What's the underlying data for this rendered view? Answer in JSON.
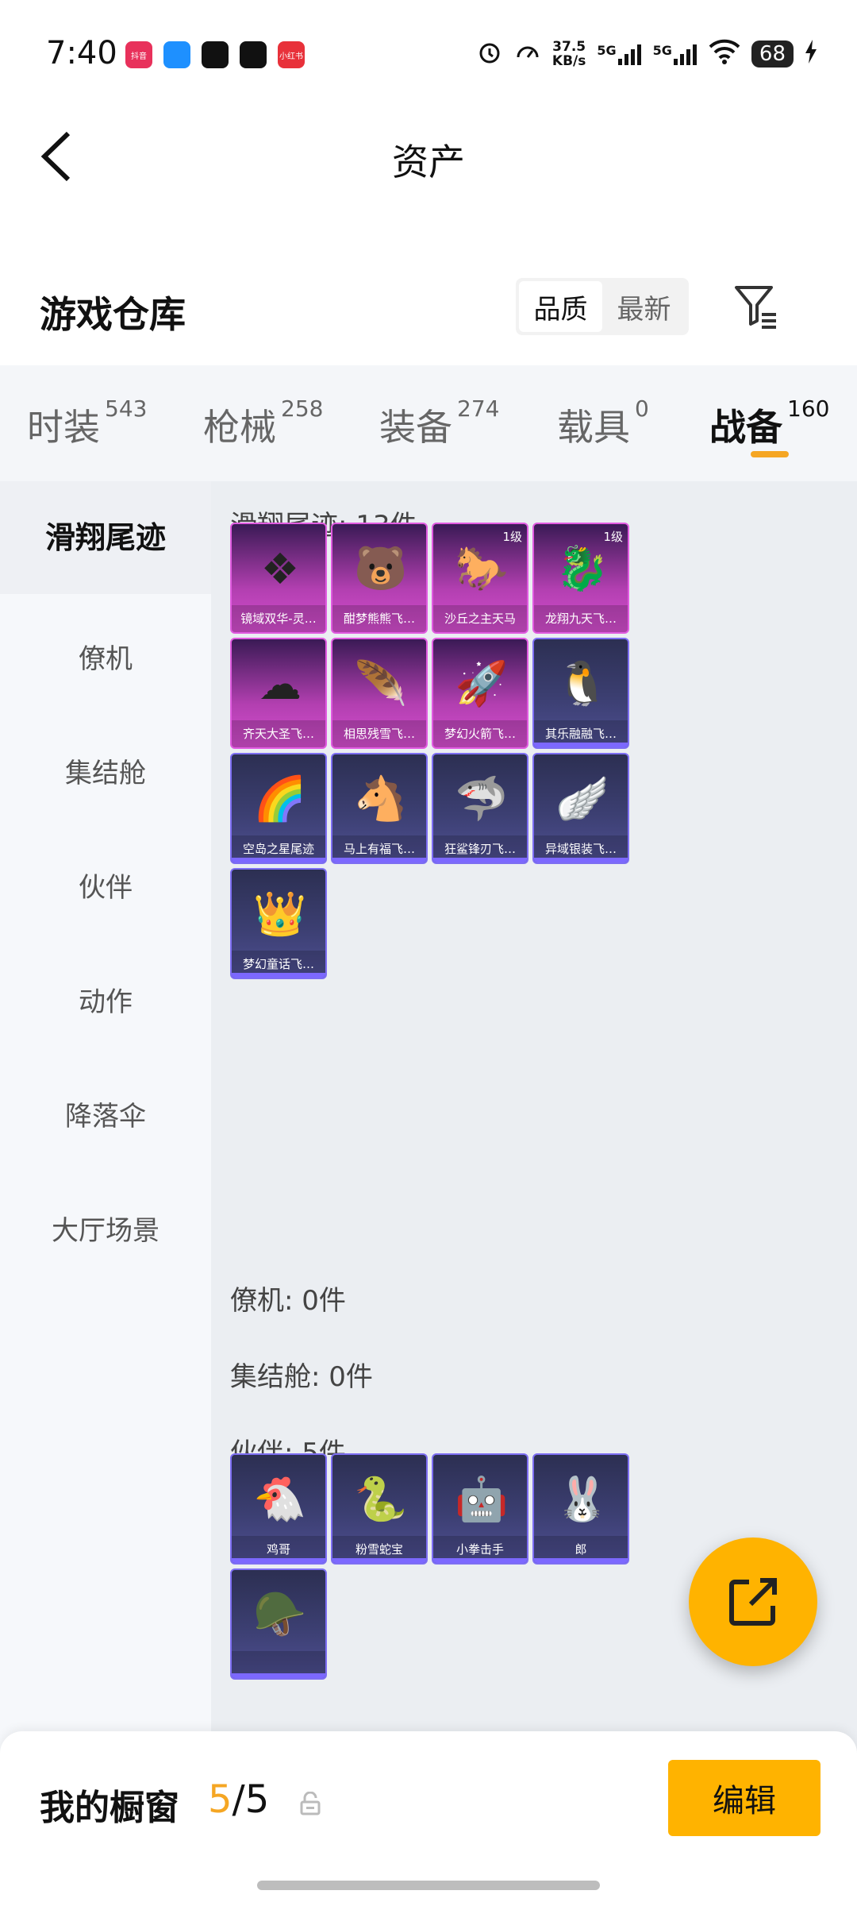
{
  "status_bar": {
    "time": "7:40",
    "app_icons": [
      {
        "name": "app-a-icon",
        "label": "抖音",
        "color": "#e8315b"
      },
      {
        "name": "app-b-icon",
        "label": "",
        "color": "#1e90ff"
      },
      {
        "name": "tiktok-icon",
        "label": "",
        "color": "#111111"
      },
      {
        "name": "tiktok-icon-2",
        "label": "",
        "color": "#111111"
      },
      {
        "name": "app-c-icon",
        "label": "小红书",
        "color": "#e8313a"
      }
    ],
    "net_speed": "37.5\nKB/s",
    "signal_1": "5G",
    "signal_2": "5G",
    "battery": "68"
  },
  "header": {
    "title": "资产"
  },
  "warehouse": {
    "title": "游戏仓库",
    "sort": {
      "quality": "品质",
      "latest": "最新"
    }
  },
  "tabs": [
    {
      "label": "时装",
      "count": "543"
    },
    {
      "label": "枪械",
      "count": "258"
    },
    {
      "label": "装备",
      "count": "274"
    },
    {
      "label": "载具",
      "count": "0"
    },
    {
      "label": "战备",
      "count": "160"
    }
  ],
  "sidebar": [
    {
      "label": "滑翔尾迹"
    },
    {
      "label": "僚机"
    },
    {
      "label": "集结舱"
    },
    {
      "label": "伙伴"
    },
    {
      "label": "动作"
    },
    {
      "label": "降落伞"
    },
    {
      "label": "大厅场景"
    }
  ],
  "sections": {
    "glide": {
      "title": "滑翔尾迹: 13件"
    },
    "wingman": {
      "title": "僚机: 0件"
    },
    "pod": {
      "title": "集结舱: 0件"
    },
    "partner": {
      "title": "伙伴: 5件"
    }
  },
  "glide_items": [
    {
      "name": "镜域双华-灵…",
      "tier": "purple",
      "level": "",
      "glyph": "❖"
    },
    {
      "name": "酣梦熊熊飞…",
      "tier": "purple",
      "level": "",
      "glyph": "🐻"
    },
    {
      "name": "沙丘之主天马",
      "tier": "purple",
      "level": "1级",
      "glyph": "🐎"
    },
    {
      "name": "龙翔九天飞…",
      "tier": "purple",
      "level": "1级",
      "glyph": "🐉"
    },
    {
      "name": "齐天大圣飞…",
      "tier": "purple",
      "level": "",
      "glyph": "☁"
    },
    {
      "name": "相思残雪飞…",
      "tier": "purple",
      "level": "",
      "glyph": "🪶"
    },
    {
      "name": "梦幻火箭飞…",
      "tier": "purple",
      "level": "",
      "glyph": "🚀"
    },
    {
      "name": "其乐融融飞…",
      "tier": "blue",
      "level": "",
      "glyph": "🐧"
    },
    {
      "name": "空岛之星尾迹",
      "tier": "blue",
      "level": "",
      "glyph": "🌈"
    },
    {
      "name": "马上有福飞…",
      "tier": "blue",
      "level": "",
      "glyph": "🐴"
    },
    {
      "name": "狂鲨锋刃飞…",
      "tier": "blue",
      "level": "",
      "glyph": "🦈"
    },
    {
      "name": "异域银装飞…",
      "tier": "blue",
      "level": "",
      "glyph": "🪽"
    },
    {
      "name": "梦幻童话飞…",
      "tier": "blue",
      "level": "",
      "glyph": "👑"
    }
  ],
  "partner_items": [
    {
      "name": "鸡哥",
      "tier": "blue",
      "level": "",
      "glyph": "🐔"
    },
    {
      "name": "粉雪蛇宝",
      "tier": "blue",
      "level": "",
      "glyph": "🐍"
    },
    {
      "name": "小拳击手",
      "tier": "blue",
      "level": "",
      "glyph": "🤖"
    },
    {
      "name": "郎",
      "tier": "blue",
      "level": "",
      "glyph": "🐰"
    },
    {
      "name": "",
      "tier": "blue",
      "level": "",
      "glyph": "🪖"
    }
  ],
  "showcase": {
    "label": "我的橱窗",
    "current": "5",
    "total": "/5"
  },
  "edit_label": "编辑",
  "colors": {
    "accent": "#ffb300",
    "tab_underline": "#f5a623",
    "purple_tier": "#d64fd0",
    "blue_tier": "#7c68ff"
  }
}
